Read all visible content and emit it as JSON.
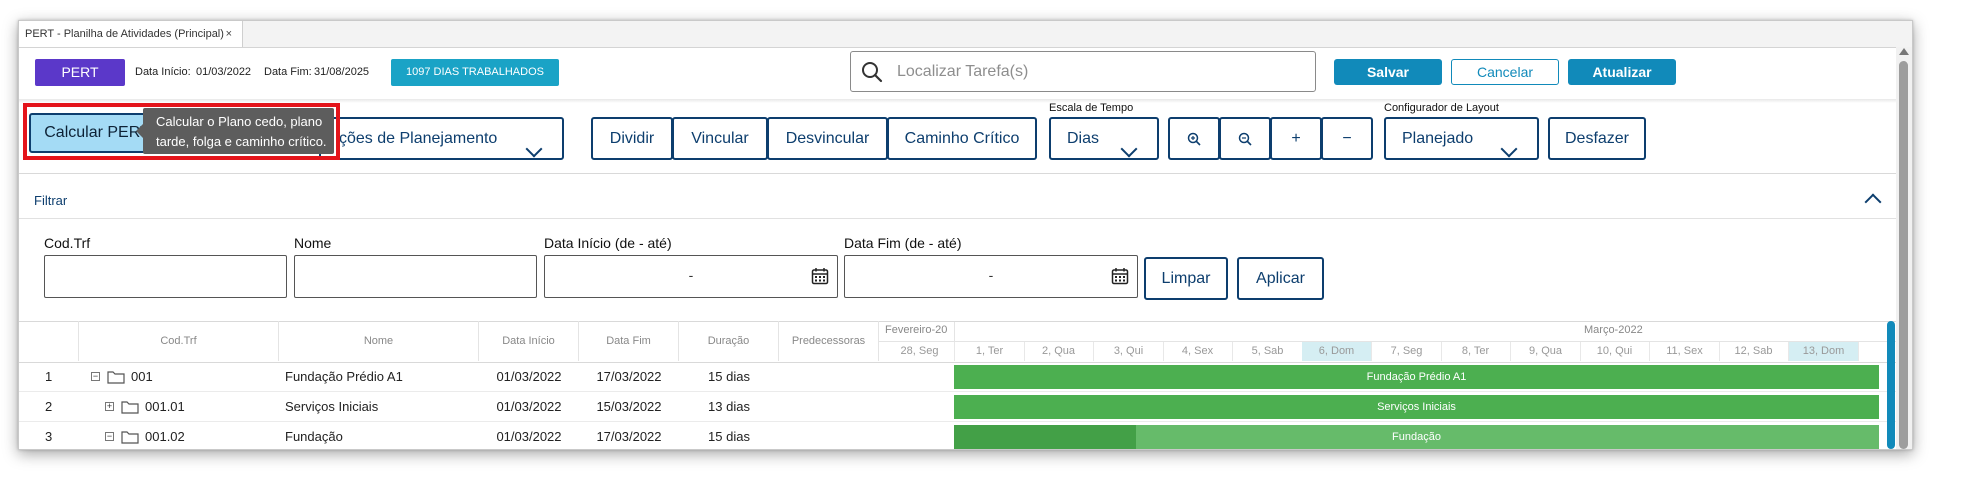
{
  "tab": {
    "title": "PERT - Planilha de Atividades (Principal)",
    "close": "×"
  },
  "header": {
    "badge": "PERT",
    "start_label": "Data Início:",
    "start_value": "01/03/2022",
    "end_label": "Data Fim:",
    "end_value": "31/08/2025",
    "days_badge": "1097 DIAS TRABALHADOS",
    "search_placeholder": "Localizar Tarefa(s)",
    "save": "Salvar",
    "cancel": "Cancelar",
    "update": "Atualizar"
  },
  "toolbar": {
    "calc": "Calcular PERT",
    "tooltip_line1": "Calcular o Plano cedo, plano",
    "tooltip_line2": "tarde, folga e caminho crítico.",
    "planning_options": "ções de Planejamento",
    "split": "Dividir",
    "link": "Vincular",
    "unlink": "Desvincular",
    "critical_path": "Caminho Crítico",
    "time_scale_label": "Escala de Tempo",
    "time_scale_value": "Dias",
    "zoom_in": "+",
    "zoom_out": "−",
    "layout_label": "Configurador de Layout",
    "layout_value": "Planejado",
    "undo": "Desfazer"
  },
  "filter": {
    "title": "Filtrar",
    "code_label": "Cod.Trf",
    "name_label": "Nome",
    "start_label": "Data Início (de - até)",
    "end_label": "Data Fim (de - até)",
    "range_placeholder": "-",
    "clear": "Limpar",
    "apply": "Aplicar"
  },
  "grid": {
    "columns": [
      "Cod.Trf",
      "Nome",
      "Data Início",
      "Data Fim",
      "Duração",
      "Predecessoras"
    ],
    "rows": [
      {
        "num": "1",
        "code": "001",
        "name": "Fundação Prédio A1",
        "start": "01/03/2022",
        "end": "17/03/2022",
        "duration": "15 dias",
        "pred": "",
        "expander": "−"
      },
      {
        "num": "2",
        "code": "001.01",
        "name": "Serviços Iniciais",
        "start": "01/03/2022",
        "end": "15/03/2022",
        "duration": "13 dias",
        "pred": "",
        "expander": "+"
      },
      {
        "num": "3",
        "code": "001.02",
        "name": "Fundação",
        "start": "01/03/2022",
        "end": "17/03/2022",
        "duration": "15 dias",
        "pred": "",
        "expander": "−"
      }
    ]
  },
  "timeline": {
    "month1": "Fevereiro-20",
    "month2": "Março-2022",
    "days": [
      "28, Seg",
      "1, Ter",
      "2, Qua",
      "3, Qui",
      "4, Sex",
      "5, Sab",
      "6, Dom",
      "7, Seg",
      "8, Ter",
      "9, Qua",
      "10, Qui",
      "11, Sex",
      "12, Sab",
      "13, Dom"
    ],
    "bars": [
      "Fundação Prédio A1",
      "Serviços Iniciais",
      "Fundação"
    ]
  },
  "colors": {
    "accent": "#118aba",
    "navy": "#0d3e6e",
    "pert_badge": "#5b38c9",
    "bar": "#4caf50",
    "highlight": "#e4141b"
  }
}
